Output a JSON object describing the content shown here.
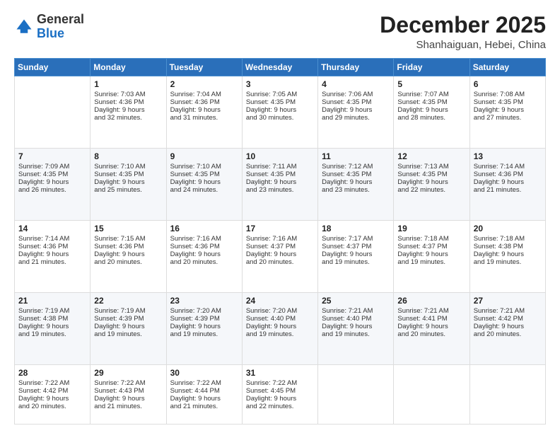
{
  "logo": {
    "general": "General",
    "blue": "Blue"
  },
  "header": {
    "month": "December 2025",
    "location": "Shanhaiguan, Hebei, China"
  },
  "weekdays": [
    "Sunday",
    "Monday",
    "Tuesday",
    "Wednesday",
    "Thursday",
    "Friday",
    "Saturday"
  ],
  "weeks": [
    [
      {
        "day": "",
        "lines": []
      },
      {
        "day": "1",
        "lines": [
          "Sunrise: 7:03 AM",
          "Sunset: 4:36 PM",
          "Daylight: 9 hours",
          "and 32 minutes."
        ]
      },
      {
        "day": "2",
        "lines": [
          "Sunrise: 7:04 AM",
          "Sunset: 4:36 PM",
          "Daylight: 9 hours",
          "and 31 minutes."
        ]
      },
      {
        "day": "3",
        "lines": [
          "Sunrise: 7:05 AM",
          "Sunset: 4:35 PM",
          "Daylight: 9 hours",
          "and 30 minutes."
        ]
      },
      {
        "day": "4",
        "lines": [
          "Sunrise: 7:06 AM",
          "Sunset: 4:35 PM",
          "Daylight: 9 hours",
          "and 29 minutes."
        ]
      },
      {
        "day": "5",
        "lines": [
          "Sunrise: 7:07 AM",
          "Sunset: 4:35 PM",
          "Daylight: 9 hours",
          "and 28 minutes."
        ]
      },
      {
        "day": "6",
        "lines": [
          "Sunrise: 7:08 AM",
          "Sunset: 4:35 PM",
          "Daylight: 9 hours",
          "and 27 minutes."
        ]
      }
    ],
    [
      {
        "day": "7",
        "lines": [
          "Sunrise: 7:09 AM",
          "Sunset: 4:35 PM",
          "Daylight: 9 hours",
          "and 26 minutes."
        ]
      },
      {
        "day": "8",
        "lines": [
          "Sunrise: 7:10 AM",
          "Sunset: 4:35 PM",
          "Daylight: 9 hours",
          "and 25 minutes."
        ]
      },
      {
        "day": "9",
        "lines": [
          "Sunrise: 7:10 AM",
          "Sunset: 4:35 PM",
          "Daylight: 9 hours",
          "and 24 minutes."
        ]
      },
      {
        "day": "10",
        "lines": [
          "Sunrise: 7:11 AM",
          "Sunset: 4:35 PM",
          "Daylight: 9 hours",
          "and 23 minutes."
        ]
      },
      {
        "day": "11",
        "lines": [
          "Sunrise: 7:12 AM",
          "Sunset: 4:35 PM",
          "Daylight: 9 hours",
          "and 23 minutes."
        ]
      },
      {
        "day": "12",
        "lines": [
          "Sunrise: 7:13 AM",
          "Sunset: 4:35 PM",
          "Daylight: 9 hours",
          "and 22 minutes."
        ]
      },
      {
        "day": "13",
        "lines": [
          "Sunrise: 7:14 AM",
          "Sunset: 4:36 PM",
          "Daylight: 9 hours",
          "and 21 minutes."
        ]
      }
    ],
    [
      {
        "day": "14",
        "lines": [
          "Sunrise: 7:14 AM",
          "Sunset: 4:36 PM",
          "Daylight: 9 hours",
          "and 21 minutes."
        ]
      },
      {
        "day": "15",
        "lines": [
          "Sunrise: 7:15 AM",
          "Sunset: 4:36 PM",
          "Daylight: 9 hours",
          "and 20 minutes."
        ]
      },
      {
        "day": "16",
        "lines": [
          "Sunrise: 7:16 AM",
          "Sunset: 4:36 PM",
          "Daylight: 9 hours",
          "and 20 minutes."
        ]
      },
      {
        "day": "17",
        "lines": [
          "Sunrise: 7:16 AM",
          "Sunset: 4:37 PM",
          "Daylight: 9 hours",
          "and 20 minutes."
        ]
      },
      {
        "day": "18",
        "lines": [
          "Sunrise: 7:17 AM",
          "Sunset: 4:37 PM",
          "Daylight: 9 hours",
          "and 19 minutes."
        ]
      },
      {
        "day": "19",
        "lines": [
          "Sunrise: 7:18 AM",
          "Sunset: 4:37 PM",
          "Daylight: 9 hours",
          "and 19 minutes."
        ]
      },
      {
        "day": "20",
        "lines": [
          "Sunrise: 7:18 AM",
          "Sunset: 4:38 PM",
          "Daylight: 9 hours",
          "and 19 minutes."
        ]
      }
    ],
    [
      {
        "day": "21",
        "lines": [
          "Sunrise: 7:19 AM",
          "Sunset: 4:38 PM",
          "Daylight: 9 hours",
          "and 19 minutes."
        ]
      },
      {
        "day": "22",
        "lines": [
          "Sunrise: 7:19 AM",
          "Sunset: 4:39 PM",
          "Daylight: 9 hours",
          "and 19 minutes."
        ]
      },
      {
        "day": "23",
        "lines": [
          "Sunrise: 7:20 AM",
          "Sunset: 4:39 PM",
          "Daylight: 9 hours",
          "and 19 minutes."
        ]
      },
      {
        "day": "24",
        "lines": [
          "Sunrise: 7:20 AM",
          "Sunset: 4:40 PM",
          "Daylight: 9 hours",
          "and 19 minutes."
        ]
      },
      {
        "day": "25",
        "lines": [
          "Sunrise: 7:21 AM",
          "Sunset: 4:40 PM",
          "Daylight: 9 hours",
          "and 19 minutes."
        ]
      },
      {
        "day": "26",
        "lines": [
          "Sunrise: 7:21 AM",
          "Sunset: 4:41 PM",
          "Daylight: 9 hours",
          "and 20 minutes."
        ]
      },
      {
        "day": "27",
        "lines": [
          "Sunrise: 7:21 AM",
          "Sunset: 4:42 PM",
          "Daylight: 9 hours",
          "and 20 minutes."
        ]
      }
    ],
    [
      {
        "day": "28",
        "lines": [
          "Sunrise: 7:22 AM",
          "Sunset: 4:42 PM",
          "Daylight: 9 hours",
          "and 20 minutes."
        ]
      },
      {
        "day": "29",
        "lines": [
          "Sunrise: 7:22 AM",
          "Sunset: 4:43 PM",
          "Daylight: 9 hours",
          "and 21 minutes."
        ]
      },
      {
        "day": "30",
        "lines": [
          "Sunrise: 7:22 AM",
          "Sunset: 4:44 PM",
          "Daylight: 9 hours",
          "and 21 minutes."
        ]
      },
      {
        "day": "31",
        "lines": [
          "Sunrise: 7:22 AM",
          "Sunset: 4:45 PM",
          "Daylight: 9 hours",
          "and 22 minutes."
        ]
      },
      {
        "day": "",
        "lines": []
      },
      {
        "day": "",
        "lines": []
      },
      {
        "day": "",
        "lines": []
      }
    ]
  ]
}
